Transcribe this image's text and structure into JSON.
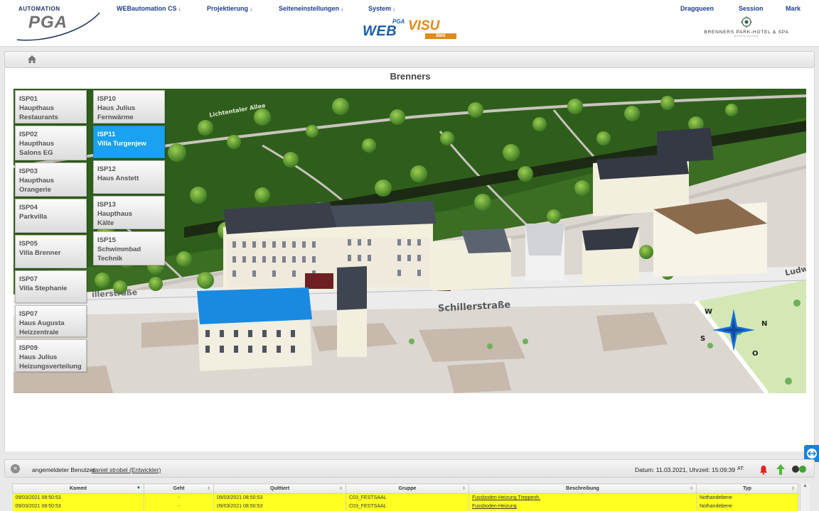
{
  "header": {
    "logo_top": "AUTOMATION",
    "logo_main": "PGA",
    "nav": [
      {
        "label": "WEBautomation CS",
        "arrow": "↓"
      },
      {
        "label": "Projektierung",
        "arrow": "↓"
      },
      {
        "label": "Seiteneinstellungen",
        "arrow": "↓"
      },
      {
        "label": "System",
        "arrow": "↓"
      }
    ],
    "right_nav": [
      "Dragqueen",
      "Session",
      "Mark"
    ],
    "webvisu": {
      "pga": "PGA",
      "web": "WEB",
      "visu": "VISU",
      "bms": "BMS"
    },
    "hotel_name": "BRENNERS PARK-HOTEL & SPA",
    "hotel_sub": "BADEN-BADEN"
  },
  "page": {
    "title": "Brenners"
  },
  "isp_buttons": [
    {
      "lines": [
        "ISP01",
        "Haupthaus",
        "Restaurants"
      ],
      "active": false
    },
    {
      "lines": [
        "ISP02",
        "Haupthaus",
        "Salons EG"
      ],
      "active": false
    },
    {
      "lines": [
        "ISP03",
        "Haupthaus",
        "Orangerie"
      ],
      "active": false
    },
    {
      "lines": [
        "ISP04",
        "Parkvilla"
      ],
      "active": false
    },
    {
      "lines": [
        "ISP05",
        "Villa Brenner"
      ],
      "active": false
    },
    {
      "lines": [
        "ISP07",
        "Villa Stephanie"
      ],
      "active": false
    },
    {
      "lines": [
        "ISP07",
        "Haus Augusta",
        "Heizzentrale"
      ],
      "active": false
    },
    {
      "lines": [
        "ISP09",
        "Haus Julius",
        "Heizungsverteilung"
      ],
      "active": false
    },
    {
      "lines": [
        "ISP10",
        "Haus Julius",
        "Fernwärme"
      ],
      "active": false
    },
    {
      "lines": [
        "ISP11",
        "Villa Turgenjew"
      ],
      "active": true
    },
    {
      "lines": [
        "ISP12",
        "Haus Anstett"
      ],
      "active": false
    },
    {
      "lines": [
        "ISP13",
        "Haupthaus",
        "Kälte"
      ],
      "active": false
    },
    {
      "lines": [
        "ISP15",
        "Schwimmbad",
        "Technik"
      ],
      "active": false
    }
  ],
  "map": {
    "street_main": "Schillerstraße",
    "street_left": "illerstraße",
    "street_top": "Lichtentaler Allee",
    "street_right": "Ludw",
    "compass": {
      "w": "W",
      "n": "N",
      "s": "S",
      "o": "O"
    }
  },
  "status": {
    "user_label": "angemeldeter Benutzer:",
    "user": "daniel strobel (Entwickler)",
    "datetime": "Datum: 11.03.2021, Uhrzeit: 15:09:39",
    "at": "AT:"
  },
  "alarm_table": {
    "columns": [
      "Kommt",
      "Geht",
      "Quittiert",
      "Gruppe",
      "Beschreibung",
      "Typ"
    ],
    "rows": [
      [
        "09/03/2021 08:50:53",
        "-",
        "09/03/2021 08:50:53",
        "C03_FESTSAAL",
        "Fussboden-Heizung Treppenh.",
        "Nothandebene"
      ],
      [
        "09/03/2021 08:50:53",
        "-",
        "09/03/2021 08:50:53",
        "C03_FESTSAAL",
        "Fussboden-Heizung",
        "Nothandebene"
      ]
    ]
  },
  "colors": {
    "nav_text": "#1d3c8e",
    "active_button": "#1aa1ef",
    "alarm_row": "#ffff22",
    "webvisu_blue": "#1a5ea8",
    "webvisu_orange": "#e08a1a"
  }
}
